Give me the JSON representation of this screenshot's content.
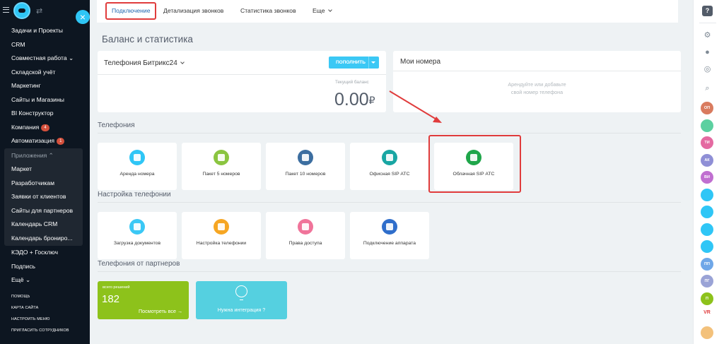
{
  "sidebar": {
    "close_glyph": "×",
    "tilde": "⇄",
    "items_top": [
      {
        "label": "Задачи и Проекты"
      },
      {
        "label": "CRM"
      },
      {
        "label": "Совместная работа ⌄"
      },
      {
        "label": "Складской учёт"
      },
      {
        "label": "Маркетинг"
      },
      {
        "label": "Сайты и Магазины"
      },
      {
        "label": "BI Конструктор"
      },
      {
        "label": "Компания",
        "badge": "4"
      },
      {
        "label": "Автоматизация",
        "badge": "1"
      }
    ],
    "group_head": "Приложения ⌃",
    "group_items": [
      {
        "label": "Маркет"
      },
      {
        "label": "Разработчикам"
      },
      {
        "label": "Заявки от клиентов"
      },
      {
        "label": "Сайты для партнеров"
      },
      {
        "label": "Календарь CRM"
      },
      {
        "label": "Календарь брониро..."
      }
    ],
    "items_bottom": [
      {
        "label": "КЭДО + Госключ"
      },
      {
        "label": "Подпись"
      },
      {
        "label": "Ещё ⌄"
      }
    ],
    "small_links": [
      "ПОМОЩЬ",
      "КАРТА САЙТА",
      "НАСТРОИТЬ МЕНЮ",
      "ПРИГЛАСИТЬ СОТРУДНИКОВ"
    ]
  },
  "tabs": [
    {
      "label": "Подключение",
      "active": true
    },
    {
      "label": "Детализация звонков"
    },
    {
      "label": "Статистика звонков"
    },
    {
      "label": "Еще"
    }
  ],
  "page_title": "Баланс и статистика",
  "telephony_card": {
    "title": "Телефония Битрикс24",
    "pay_button": "пополнить",
    "balance_label": "Текущий баланс",
    "balance_amount": "0.00",
    "currency": "₽"
  },
  "numbers_card": {
    "title": "Мои номера",
    "empty_line1": "Арендуйте или добавьте",
    "empty_line2": "свой номер телефона"
  },
  "sections": {
    "telephony": "Телефония",
    "settings": "Настройка телефонии",
    "partners": "Телефония от партнеров"
  },
  "telephony_tiles": [
    {
      "label": "Аренда номера",
      "color": "#2fc6f6"
    },
    {
      "label": "Пакет 5 номеров",
      "color": "#8bc540"
    },
    {
      "label": "Пакет 10 номеров",
      "color": "#3c6ea0"
    },
    {
      "label": "Офисная SIP АТС",
      "color": "#18a6a3"
    },
    {
      "label": "Облачная SIP АТС",
      "color": "#1fa64a"
    }
  ],
  "settings_tiles": [
    {
      "label": "Загрузка документов",
      "color": "#3bc8f5"
    },
    {
      "label": "Настройка телефонии",
      "color": "#f6a623"
    },
    {
      "label": "Права доступа",
      "color": "#f0749a"
    },
    {
      "label": "Подключение аппарата",
      "color": "#2f6ecb"
    }
  ],
  "partners": {
    "solutions_label": "всего решений",
    "solutions_count": "182",
    "view_all": "Посмотреть все →",
    "integration": "Нужна интеграция ?"
  },
  "rightbar": {
    "help": "?",
    "avatars": [
      {
        "initials": "ОП",
        "color": "#d97b5f"
      },
      {
        "initials": "",
        "color": "#5cd0a0"
      },
      {
        "initials": "ТИ",
        "color": "#e46aa1"
      },
      {
        "initials": "АК",
        "color": "#8f8fd6"
      },
      {
        "initials": "ВИ",
        "color": "#c06fd0"
      },
      {
        "initials": "",
        "color": "#2fc6f6"
      },
      {
        "initials": "",
        "color": "#2fc6f6"
      },
      {
        "initials": "",
        "color": "#2fc6f6"
      },
      {
        "initials": "",
        "color": "#2fc6f6"
      },
      {
        "initials": "ПП",
        "color": "#6fa7e8"
      },
      {
        "initials": "ПГ",
        "color": "#9aa3d6"
      },
      {
        "initials": "П",
        "color": "#8dc21b"
      }
    ],
    "vr_label": "VR"
  }
}
